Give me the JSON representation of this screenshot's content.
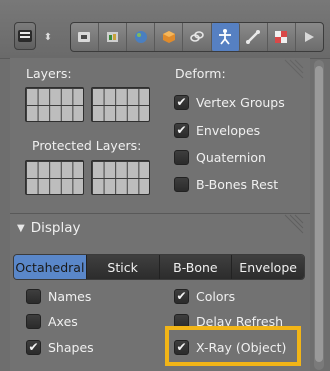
{
  "header": {
    "tabs": [
      "render",
      "scene",
      "world",
      "object",
      "constraints",
      "data",
      "bone",
      "material",
      "texture"
    ],
    "active_tab": "data"
  },
  "panel": {
    "layers_label": "Layers:",
    "protected_layers_label": "Protected Layers:",
    "deform_label": "Deform:",
    "deform_items": [
      {
        "label": "Vertex Groups",
        "checked": true
      },
      {
        "label": "Envelopes",
        "checked": true
      },
      {
        "label": "Quaternion",
        "checked": false
      },
      {
        "label": "B-Bones Rest",
        "checked": false
      }
    ],
    "display_heading": "Display",
    "display_modes": [
      "Octahedral",
      "Stick",
      "B-Bone",
      "Envelope"
    ],
    "active_display_mode": "Octahedral",
    "left_options": [
      {
        "label": "Names",
        "checked": false
      },
      {
        "label": "Axes",
        "checked": false
      },
      {
        "label": "Shapes",
        "checked": true
      }
    ],
    "right_options": [
      {
        "label": "Colors",
        "checked": true
      },
      {
        "label": "Delay Refresh",
        "checked": false
      },
      {
        "label": "X-Ray (Object)",
        "checked": true
      }
    ]
  },
  "colors": {
    "highlight": "#f2b517",
    "active_blue": "#5a87c9"
  }
}
